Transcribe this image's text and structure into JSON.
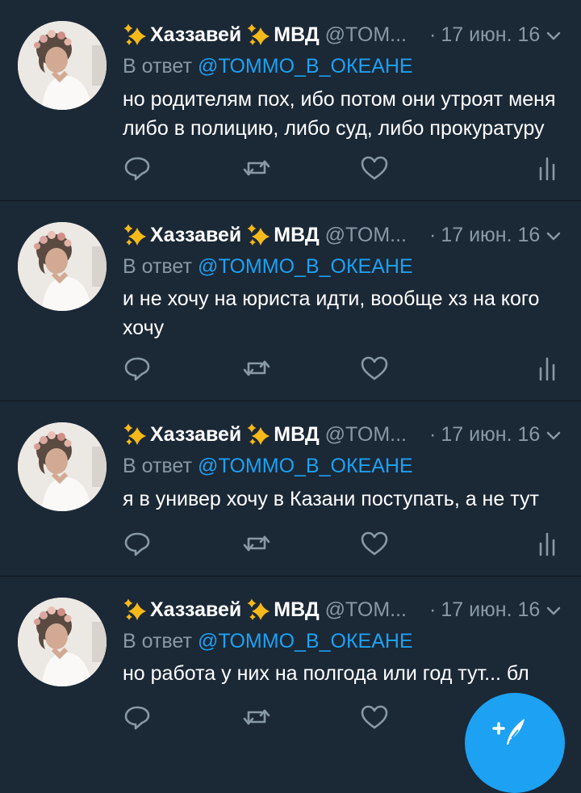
{
  "tweets": [
    {
      "author": {
        "name_left": "Хаззавей",
        "name_right": "МВД",
        "handle": "@TOM...",
        "date": "17 июн. 16",
        "separator": "·"
      },
      "reply": {
        "label": "В ответ",
        "to": "@ТОММО_В_ОКЕАНЕ"
      },
      "text": "но родителям пох, ибо потом они утроят меня либо в полицию, либо суд, либо прокуратуру"
    },
    {
      "author": {
        "name_left": "Хаззавей",
        "name_right": "МВД",
        "handle": "@TOM...",
        "date": "17 июн. 16",
        "separator": "·"
      },
      "reply": {
        "label": "В ответ",
        "to": "@ТОММО_В_ОКЕАНЕ"
      },
      "text": "и не хочу на юриста идти, вообще хз на кого хочу"
    },
    {
      "author": {
        "name_left": "Хаззавей",
        "name_right": "МВД",
        "handle": "@TOM...",
        "date": "17 июн. 16",
        "separator": "·"
      },
      "reply": {
        "label": "В ответ",
        "to": "@ТОММО_В_ОКЕАНЕ"
      },
      "text": "я в универ хочу в Казани поступать, а не тут"
    },
    {
      "author": {
        "name_left": "Хаззавей",
        "name_right": "МВД",
        "handle": "@TOM...",
        "date": "17 июн. 16",
        "separator": "·"
      },
      "reply": {
        "label": "В ответ",
        "to": "@ТОММО_В_ОКЕАНЕ"
      },
      "text": "но работа у них на полгода или год тут... бл"
    }
  ],
  "icons": {
    "name_decoration": "sparkles-icon",
    "reply": "reply-icon",
    "retweet": "retweet-icon",
    "like": "heart-icon",
    "analytics": "analytics-icon",
    "more": "chevron-down-icon",
    "compose": "compose-tweet-icon"
  },
  "colors": {
    "background": "#1b2836",
    "divider": "#0e161f",
    "text_primary": "#ffffff",
    "text_secondary": "#8899a6",
    "accent": "#1da1f2",
    "sparkle": "#f5b91a"
  }
}
